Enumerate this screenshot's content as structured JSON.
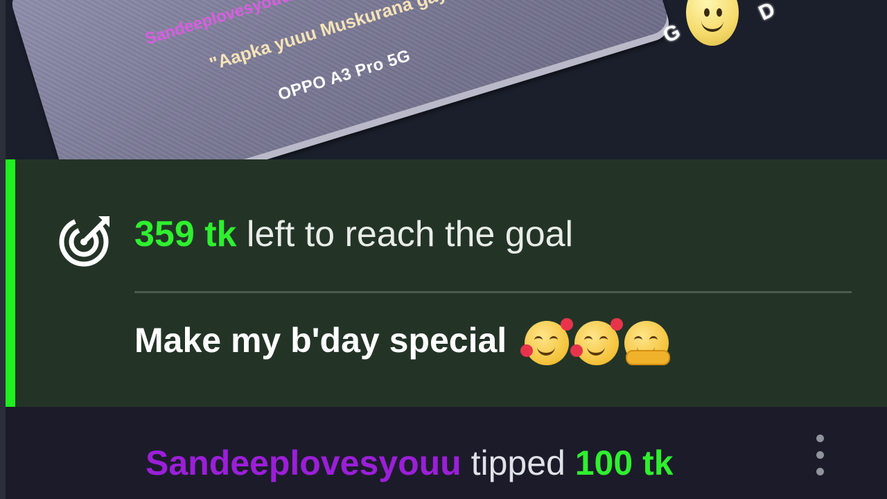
{
  "image_overlay": {
    "username": "Sandeeplovesyouu",
    "quote": "\"Aapka yuuu Muskurana gaya\"",
    "phone_model": "OPPO A3 Pro 5G",
    "sticker_letters": [
      "G",
      "D"
    ]
  },
  "goal": {
    "icon": "target-icon",
    "amount": "359 tk",
    "text": "left to reach the goal",
    "title": "Make my b'day special",
    "emojis": [
      "smiling-face-with-hearts",
      "smiling-face-with-hearts",
      "hugging-face"
    ],
    "accent_color": "#1ff01f"
  },
  "tip": {
    "username": "Sandeeplovesyouu",
    "action": "tipped",
    "amount": "100 tk",
    "username_color": "#9b1fd8",
    "amount_color": "#2ff02f",
    "menu_icon": "more-vertical-icon"
  }
}
